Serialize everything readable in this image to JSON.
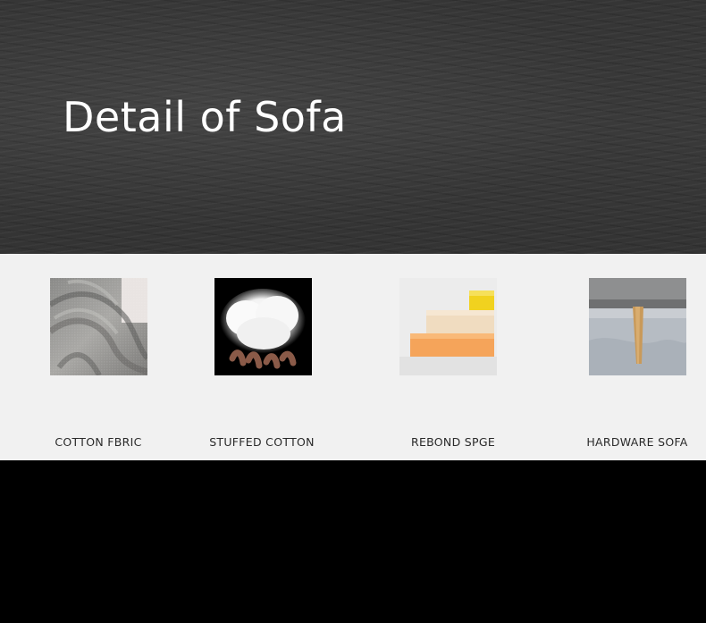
{
  "hero": {
    "title": "Detail of Sofa"
  },
  "features": [
    {
      "label": "COTTON FBRIC",
      "icon": "cotton-fabric-image"
    },
    {
      "label": "STUFFED COTTON",
      "icon": "stuffed-cotton-image"
    },
    {
      "label": "REBOND SPGE",
      "icon": "rebond-sponge-image"
    },
    {
      "label": "HARDWARE SOFA",
      "icon": "hardware-sofa-leg-image"
    }
  ]
}
